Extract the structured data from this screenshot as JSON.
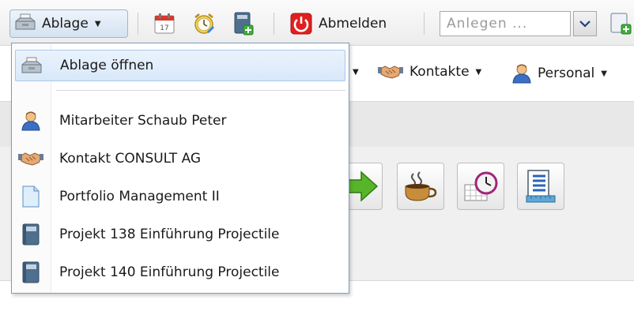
{
  "toolbar": {
    "ablage_label": "Ablage",
    "abmelden_label": "Abmelden",
    "anlegen_placeholder": "Anlegen ...",
    "icons": [
      "folder-tray-icon",
      "calendar-icon",
      "alarm-clock-icon",
      "new-document-icon",
      "power-icon",
      "dropdown-arrow-icon",
      "new-page-icon"
    ],
    "calendar_day": "17"
  },
  "subnav": {
    "items": [
      {
        "label": "Kontakte",
        "icon": "handshake-icon"
      },
      {
        "label": "Personal",
        "icon": "person-icon"
      }
    ]
  },
  "menu": {
    "items": [
      {
        "label": "Ablage öffnen",
        "icon": "folder-tray-icon"
      },
      {
        "label": "Mitarbeiter Schaub Peter",
        "icon": "person-icon"
      },
      {
        "label": "Kontakt CONSULT AG",
        "icon": "handshake-icon"
      },
      {
        "label": "Portfolio Management II",
        "icon": "document-icon"
      },
      {
        "label": "Projekt 138 Einführung Projectile",
        "icon": "binder-icon"
      },
      {
        "label": "Projekt 140 Einführung Projectile",
        "icon": "binder-icon"
      }
    ]
  },
  "content_buttons": [
    "arrow-right-icon",
    "coffee-cup-icon",
    "clock-calendar-icon",
    "ruler-list-icon"
  ],
  "colors": {
    "accent": "#7f9db9",
    "highlight": "#d8e8fa",
    "power_red": "#e02020",
    "arrow_green": "#57b52a"
  }
}
